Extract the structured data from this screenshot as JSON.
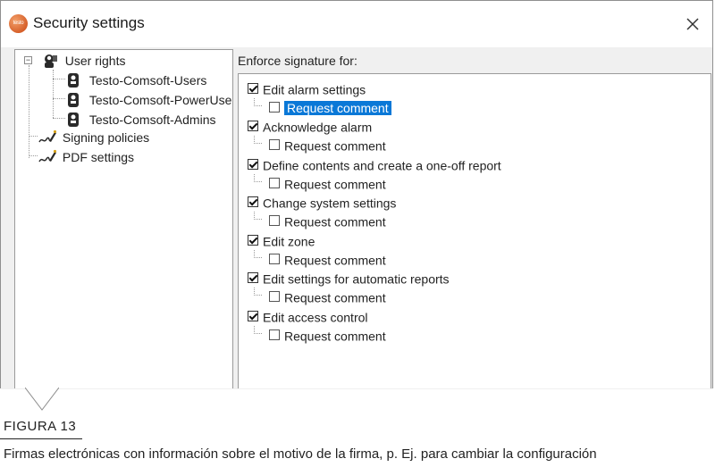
{
  "window": {
    "title": "Security settings",
    "app_icon_text": "testo",
    "close_glyph": "×"
  },
  "tree": {
    "items": [
      {
        "label": "User rights",
        "icon": "user-rights-icon",
        "expander": "−"
      },
      {
        "label": "Testo-Comsoft-Users",
        "icon": "user-group-icon"
      },
      {
        "label": "Testo-Comsoft-PowerUse",
        "icon": "user-group-icon"
      },
      {
        "label": "Testo-Comsoft-Admins",
        "icon": "user-group-icon"
      },
      {
        "label": "Signing policies",
        "icon": "signature-pen-icon"
      },
      {
        "label": "PDF settings",
        "icon": "signature-pen-icon"
      }
    ]
  },
  "enforce": {
    "heading": "Enforce signature for:",
    "options": [
      {
        "label": "Edit alarm settings",
        "checked": true,
        "sub_label": "Request comment",
        "sub_checked": false,
        "sub_selected": true
      },
      {
        "label": "Acknowledge alarm",
        "checked": true,
        "sub_label": "Request comment",
        "sub_checked": false
      },
      {
        "label": "Define contents and create a one-off report",
        "checked": true,
        "sub_label": "Request comment",
        "sub_checked": false
      },
      {
        "label": "Change system settings",
        "checked": true,
        "sub_label": "Request comment",
        "sub_checked": false
      },
      {
        "label": "Edit zone",
        "checked": true,
        "sub_label": "Request comment",
        "sub_checked": false
      },
      {
        "label": "Edit settings for automatic reports",
        "checked": true,
        "sub_label": "Request comment",
        "sub_checked": false
      },
      {
        "label": "Edit access control",
        "checked": true,
        "sub_label": "Request comment",
        "sub_checked": false
      }
    ]
  },
  "caption": {
    "figure": "FIGURA 13",
    "text": "Firmas electrónicas con información sobre el motivo de la firma, p. Ej. para cambiar la configuración"
  },
  "colors": {
    "selection": "#0a78d7",
    "app_icon": "#d6602a",
    "window_bg": "#f0f0f0"
  }
}
